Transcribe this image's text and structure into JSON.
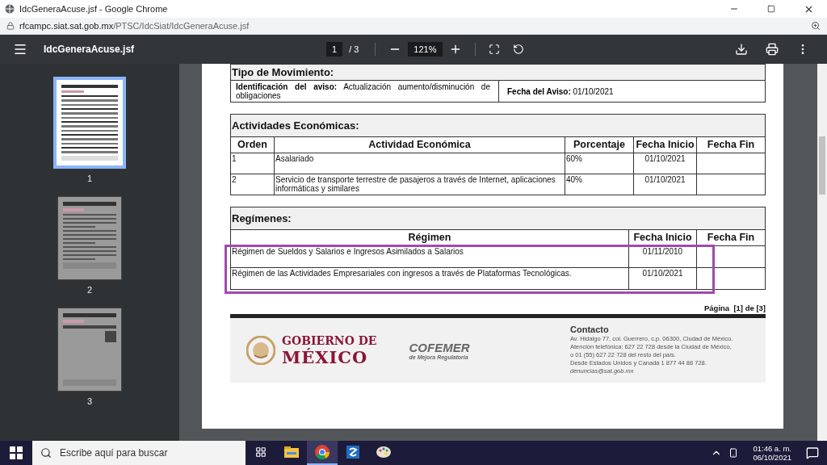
{
  "window": {
    "title": "IdcGeneraAcuse.jsf - Google Chrome"
  },
  "address": {
    "host": "rfcampc.siat.sat.gob.mx",
    "path": "/PTSC/IdcSiat/IdcGeneraAcuse.jsf"
  },
  "viewer": {
    "file_name": "IdcGeneraAcuse.jsf",
    "page": "1",
    "page_total": "/ 3",
    "zoom": "121%"
  },
  "sidebar": {
    "thumbnails": [
      {
        "label": "1",
        "selected": true,
        "kind": "form"
      },
      {
        "label": "2",
        "selected": false,
        "kind": "text"
      },
      {
        "label": "3",
        "selected": false,
        "kind": "qr"
      }
    ]
  },
  "document": {
    "movement": {
      "title": "Tipo de Movimiento:",
      "notice_label": "Identificación del aviso:",
      "notice_value": "Actualización aumento/disminución de obligaciones",
      "date_label": "Fecha del Aviso:",
      "date_value": "01/10/2021"
    },
    "activities": {
      "title": "Actividades Económicas:",
      "columns": [
        "Orden",
        "Actividad Económica",
        "Porcentaje",
        "Fecha Inicio",
        "Fecha Fin"
      ],
      "rows": [
        [
          "1",
          "Asalariado",
          "60%",
          "01/10/2021",
          ""
        ],
        [
          "2",
          "Servicio de transporte terrestre de pasajeros a través de Internet, aplicaciones informáticas y similares",
          "40%",
          "01/10/2021",
          ""
        ]
      ]
    },
    "regimes": {
      "title": "Regímenes:",
      "columns": [
        "Régimen",
        "Fecha Inicio",
        "Fecha Fin"
      ],
      "highlighted": true,
      "rows": [
        [
          "Régimen de Sueldos y Salarios e Ingresos Asimilados a Salarios",
          "01/11/2010",
          ""
        ],
        [
          "Régimen de las Actividades Empresariales con ingresos a través de Plataformas Tecnológicas.",
          "01/10/2021",
          ""
        ]
      ]
    },
    "page_label": "Página  [1] de [3]",
    "footer": {
      "gov_line1": "GOBIERNO DE",
      "gov_line2": "MÉXICO",
      "cofemer": "COFEMER",
      "cofemer_sub": "de Mejora Regulatoria",
      "contact_title": "Contacto",
      "contact_lines": [
        "Av. Hidalgo 77, col. Guerrero, c.p. 06300, Ciudad de México.",
        "Atención telefónica: 627 22 728 desde la Ciudad de México,",
        "o 01 (55) 627 22 728 del resto del país.",
        "Desde Estados Unidos y Canadá 1 877 44 88 728."
      ],
      "contact_email": "denuncias@sat.gob.mx"
    }
  },
  "taskbar": {
    "search": {
      "placeholder": "Escribe aquí para buscar"
    },
    "apps": [
      {
        "kind": "folder",
        "selected": false
      },
      {
        "kind": "chrome",
        "selected": true
      },
      {
        "kind": "blue",
        "selected": false
      },
      {
        "kind": "paint",
        "selected": false
      }
    ],
    "time": "01:46 a. m.",
    "date": "06/10/2021"
  }
}
